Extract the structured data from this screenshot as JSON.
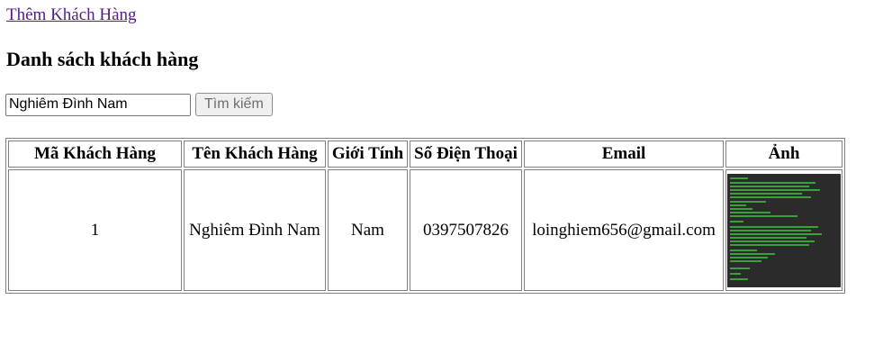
{
  "nav": {
    "add_customer_label": "Thêm Khách Hàng"
  },
  "page": {
    "title": "Danh sách khách hàng"
  },
  "search": {
    "value": "Nghiêm Đình Nam",
    "button_label": "Tìm kiếm"
  },
  "table": {
    "headers": [
      "Mã Khách Hàng",
      "Tên Khách Hàng",
      "Giới Tính",
      "Số Điện Thoại",
      "Email",
      "Ảnh"
    ],
    "rows": [
      {
        "id": "1",
        "name": "Nghiêm Đình Nam",
        "gender": "Nam",
        "phone": "0397507826",
        "email": "loinghiem656@gmail.com"
      }
    ]
  },
  "colors": {
    "link": "#551a8b",
    "photo_bg": "#2b2b2b",
    "photo_text": "#3fbf3f"
  }
}
